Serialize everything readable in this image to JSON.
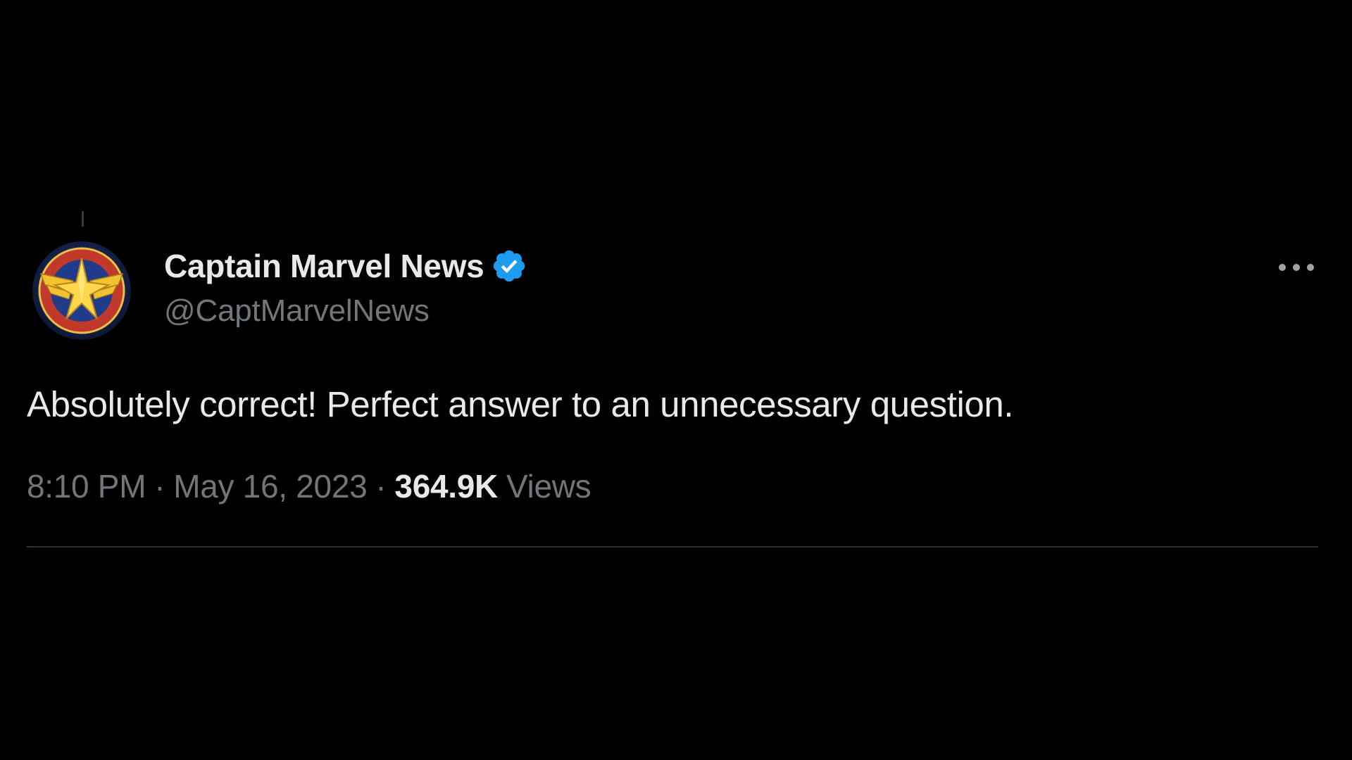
{
  "tweet": {
    "author": {
      "display_name": "Captain Marvel News",
      "handle": "@CaptMarvelNews",
      "verified": true
    },
    "text": "Absolutely correct! Perfect answer to an unnecessary question.",
    "time": "8:10 PM",
    "separator": "·",
    "date": "May 16, 2023",
    "views_count": "364.9K",
    "views_label": "Views"
  },
  "icons": {
    "avatar": "captain-marvel-emblem",
    "verified": "verified-badge-icon",
    "more": "more-options-icon"
  },
  "colors": {
    "background": "#000000",
    "primary_text": "#e7e9ea",
    "secondary_text": "#71767b",
    "verified_blue": "#1d9bf0",
    "divider": "#2f3336"
  }
}
